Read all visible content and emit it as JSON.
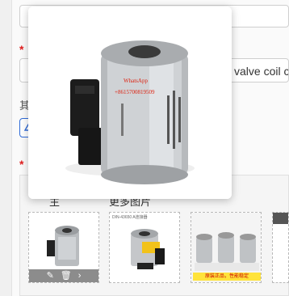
{
  "form": {
    "required_mark": "*",
    "title_field_value": "l valve coil cra",
    "side_label": "其",
    "panel_label_left": "主",
    "panel_label_right": "更多图片"
  },
  "popup": {
    "watermark_line1": "WhatsApp",
    "watermark_line2": "+8615700819509"
  },
  "thumbnails": [
    {
      "alt": "solenoid-coil-main"
    },
    {
      "alt": "solenoid-coil-with-connector",
      "caption": "DIN-43650 A连接器"
    },
    {
      "alt": "solenoid-coil-set",
      "caption": "原装正品，性能稳定"
    },
    {
      "alt": "partial-thumbnail"
    }
  ],
  "thumb_actions": {
    "edit": "✎",
    "delete": "🗑",
    "next": "›"
  },
  "colors": {
    "accent": "#2f6bd8",
    "required": "#e02020"
  }
}
